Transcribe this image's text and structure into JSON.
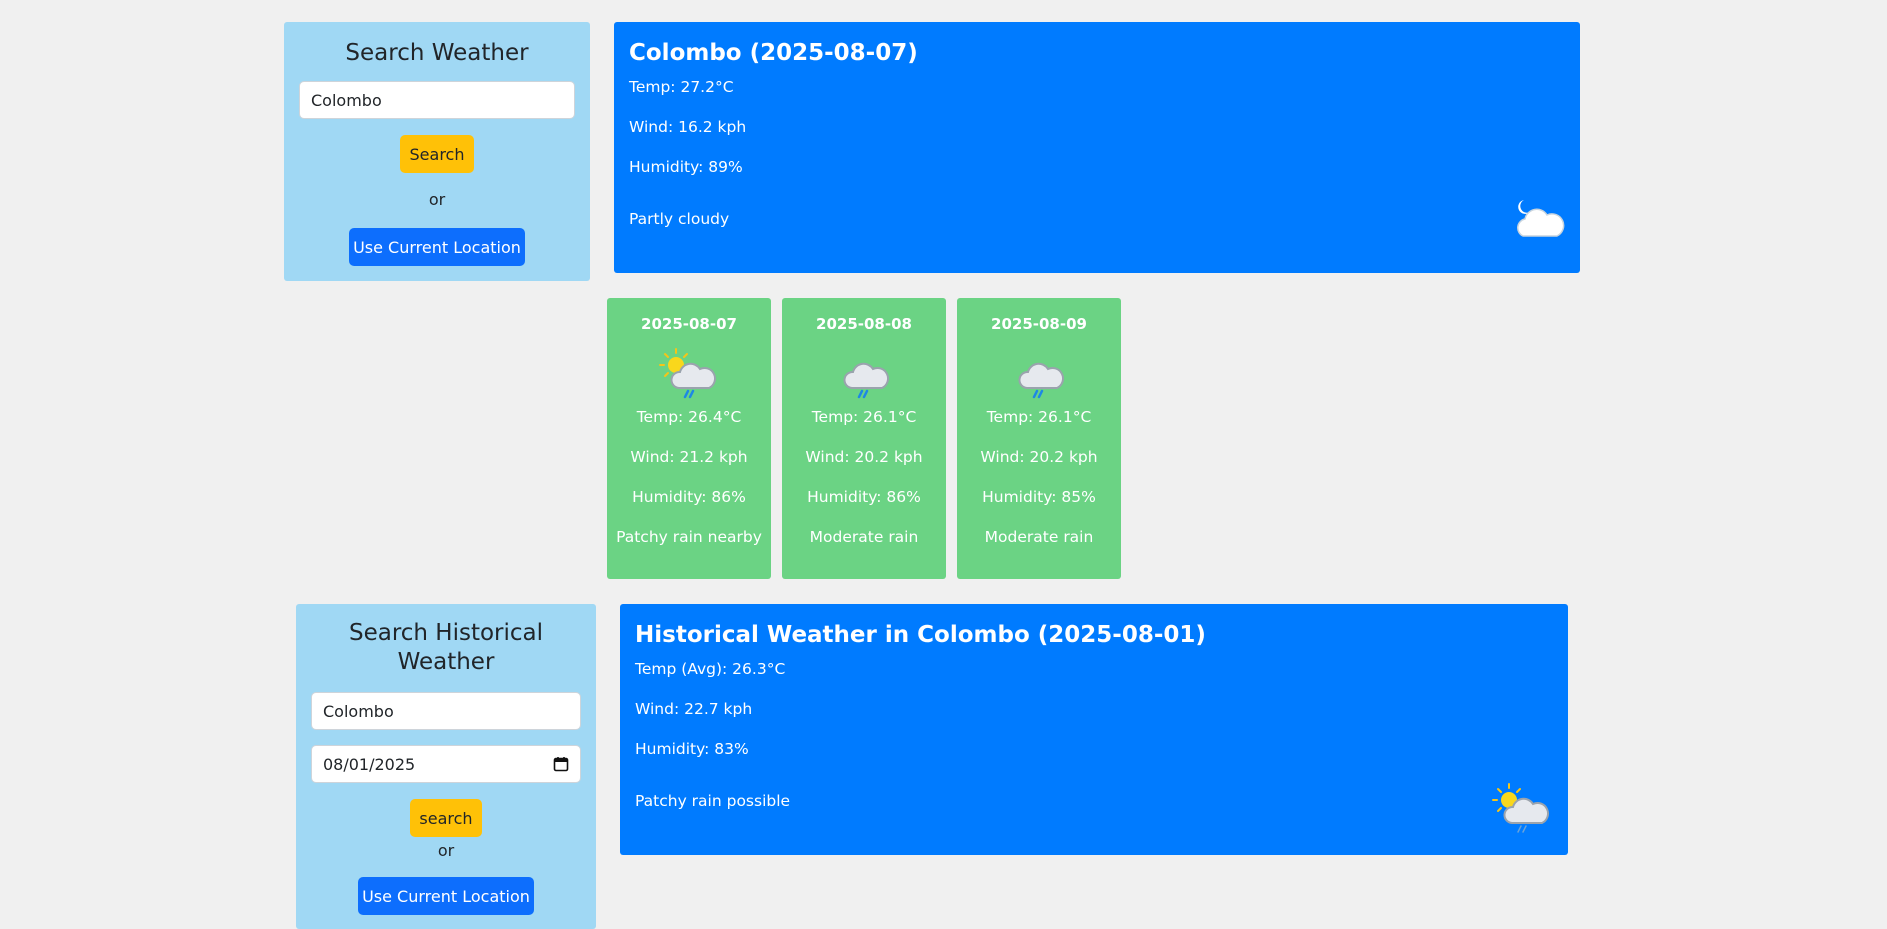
{
  "search": {
    "title": "Search Weather",
    "city_value": "Colombo",
    "search_label": "Search",
    "or_text": "or",
    "location_label": "Use Current Location"
  },
  "current": {
    "title": "Colombo (2025-08-07)",
    "temp": "Temp: 27.2°C",
    "wind": "Wind: 16.2 kph",
    "humidity": "Humidity: 89%",
    "condition": "Partly cloudy",
    "icon": "moon-cloud-icon"
  },
  "forecast": [
    {
      "date": "2025-08-07",
      "icon": "sun-cloud-rain-icon",
      "temp": "Temp: 26.4°C",
      "wind": "Wind: 21.2 kph",
      "humidity": "Humidity: 86%",
      "condition": "Patchy rain nearby"
    },
    {
      "date": "2025-08-08",
      "icon": "cloud-rain-icon",
      "temp": "Temp: 26.1°C",
      "wind": "Wind: 20.2 kph",
      "humidity": "Humidity: 86%",
      "condition": "Moderate rain"
    },
    {
      "date": "2025-08-09",
      "icon": "cloud-rain-icon",
      "temp": "Temp: 26.1°C",
      "wind": "Wind: 20.2 kph",
      "humidity": "Humidity: 85%",
      "condition": "Moderate rain"
    }
  ],
  "history_search": {
    "title_line1": "Search Historical",
    "title_line2": "Weather",
    "city_value": "Colombo",
    "date_value": "08/01/2025",
    "search_label": "search",
    "or_text": "or",
    "location_label": "Use Current Location"
  },
  "history": {
    "title": "Historical Weather in Colombo (2025-08-01)",
    "temp": "Temp (Avg): 26.3°C",
    "wind": "Wind: 22.7 kph",
    "humidity": "Humidity: 83%",
    "condition": "Patchy rain possible",
    "icon": "sun-cloud-rain-icon"
  },
  "colors": {
    "background": "#f0f0f0",
    "search_panel": "#a0d8f4",
    "result_panel": "#007bff",
    "forecast_card": "#6bd384",
    "btn_yellow": "#ffc107",
    "btn_blue": "#0d6efd"
  }
}
